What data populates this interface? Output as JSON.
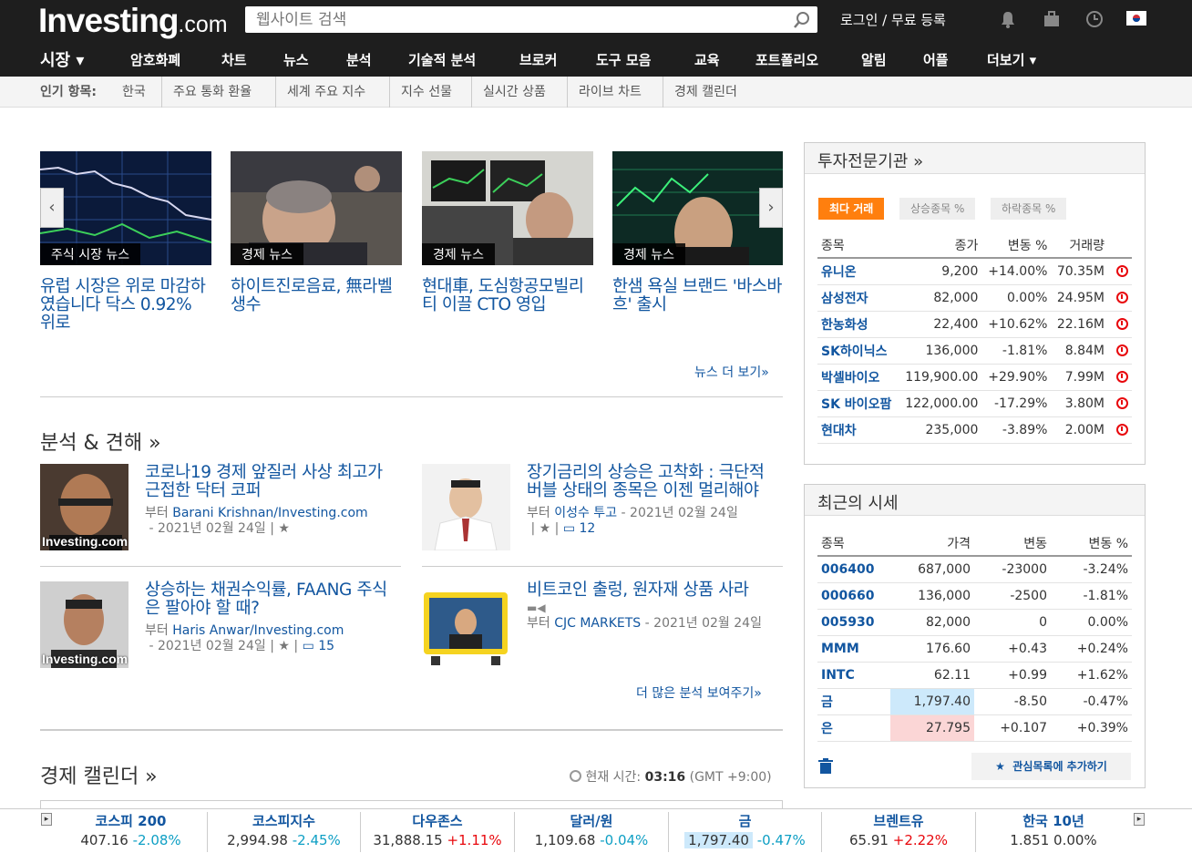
{
  "header": {
    "logo_main": "Investing",
    "logo_suffix": ".com",
    "search_placeholder": "웹사이트 검색",
    "login": "로그인 / 무료 등록"
  },
  "nav": {
    "items": [
      "시장 ▾",
      "암호화폐",
      "차트",
      "뉴스",
      "분석",
      "기술적 분석",
      "브로커",
      "도구 모음",
      "교육",
      "포트폴리오",
      "알림",
      "어플",
      "더보기 ▾"
    ]
  },
  "popular": {
    "label": "인기 항목:",
    "items": [
      "한국",
      "주요 통화 환율",
      "세계 주요 지수",
      "지수 선물",
      "실시간 상품",
      "라이브 차트",
      "경제 캘린더"
    ]
  },
  "news": {
    "items": [
      {
        "tag": "주식 시장 뉴스",
        "title": "유럽 시장은 위로 마감하였습니다 닥스 0.92% 위로"
      },
      {
        "tag": "경제 뉴스",
        "title": "하이트진로음료, 無라벨 생수"
      },
      {
        "tag": "경제 뉴스",
        "title": "현대車, 도심항공모빌리티 이끌 CTO 영입"
      },
      {
        "tag": "경제 뉴스",
        "title": "한샘 욕실 브랜드 '바스바흐' 출시"
      }
    ],
    "more": "뉴스 더 보기»"
  },
  "analysis": {
    "heading": "분석 & 견해 »",
    "items": [
      {
        "title": "코로나19 경제 앞질러 사상 최고가 근접한 닥터 코퍼",
        "by": "부터",
        "author": "Barani Krishnan/Investing.com",
        "date": "- 2021년 02월 24일",
        "comments": ""
      },
      {
        "title": "장기금리의 상승은 고착화 : 극단적 버블 상태의 종목은 이젠 멀리해야",
        "by": "부터",
        "author": "이성수 투고",
        "date": "- 2021년 02월 24일",
        "comments": "12"
      },
      {
        "title": "상승하는 채권수익률, FAANG 주식은 팔아야 할 때?",
        "by": "부터",
        "author": "Haris Anwar/Investing.com",
        "date": "- 2021년 02월 24일",
        "comments": "15"
      },
      {
        "title": "비트코인 출렁, 원자재 상품 사라",
        "by": "부터",
        "author": "CJC MARKETS",
        "date": "- 2021년 02월 24일",
        "comments": ""
      }
    ],
    "watermark": "Investing.com",
    "more": "더 많은 분석 보여주기»"
  },
  "calendar": {
    "heading": "경제 캘린더 »",
    "time_label": "현재 시간:",
    "time": "03:16",
    "tz": "(GMT +9:00)"
  },
  "pros": {
    "heading": "투자전문기관 »",
    "tabs": [
      "최다 거래",
      "상승종목 %",
      "하락종목 %"
    ],
    "columns": [
      "종목",
      "종가",
      "변동 %",
      "거래량"
    ],
    "rows": [
      {
        "name": "유니온",
        "price": "9,200",
        "chg": "+14.00%",
        "dir": "up",
        "vol": "70.35M"
      },
      {
        "name": "삼성전자",
        "price": "82,000",
        "chg": "0.00%",
        "dir": "flat",
        "vol": "24.95M"
      },
      {
        "name": "한농화성",
        "price": "22,400",
        "chg": "+10.62%",
        "dir": "up",
        "vol": "22.16M"
      },
      {
        "name": "SK하이닉스",
        "price": "136,000",
        "chg": "-1.81%",
        "dir": "dn",
        "vol": "8.84M"
      },
      {
        "name": "박셀바이오",
        "price": "119,900.00",
        "chg": "+29.90%",
        "dir": "up",
        "vol": "7.99M"
      },
      {
        "name": "SK 바이오팜",
        "price": "122,000.00",
        "chg": "-17.29%",
        "dir": "dn",
        "vol": "3.80M"
      },
      {
        "name": "현대차",
        "price": "235,000",
        "chg": "-3.89%",
        "dir": "dn",
        "vol": "2.00M"
      }
    ]
  },
  "recent": {
    "heading": "최근의 시세",
    "columns": [
      "종목",
      "가격",
      "변동",
      "변동 %"
    ],
    "rows": [
      {
        "name": "006400",
        "price": "687,000",
        "chg": "-23000",
        "pct": "-3.24%",
        "dir": "dn",
        "hl": ""
      },
      {
        "name": "000660",
        "price": "136,000",
        "chg": "-2500",
        "pct": "-1.81%",
        "dir": "dn",
        "hl": ""
      },
      {
        "name": "005930",
        "price": "82,000",
        "chg": "0",
        "pct": "0.00%",
        "dir": "flat",
        "hl": ""
      },
      {
        "name": "MMM",
        "price": "176.60",
        "chg": "+0.43",
        "pct": "+0.24%",
        "dir": "up",
        "hl": ""
      },
      {
        "name": "INTC",
        "price": "62.11",
        "chg": "+0.99",
        "pct": "+1.62%",
        "dir": "up",
        "hl": ""
      },
      {
        "name": "금",
        "price": "1,797.40",
        "chg": "-8.50",
        "pct": "-0.47%",
        "dir": "dn",
        "hl": "#cde9fb"
      },
      {
        "name": "은",
        "price": "27.795",
        "chg": "+0.107",
        "pct": "+0.39%",
        "dir": "up",
        "hl": "#fbd6d6"
      }
    ],
    "add_watchlist": "관심목록에 추가하기"
  },
  "ticker": {
    "items": [
      {
        "name": "코스피 200",
        "value": "407.16",
        "chg": "-2.08%",
        "dir": "dn"
      },
      {
        "name": "코스피지수",
        "value": "2,994.98",
        "chg": "-2.45%",
        "dir": "dn"
      },
      {
        "name": "다우존스",
        "value": "31,888.15",
        "chg": "+1.11%",
        "dir": "up"
      },
      {
        "name": "달러/원",
        "value": "1,109.68",
        "chg": "-0.04%",
        "dir": "dn"
      },
      {
        "name": "금",
        "value": "1,797.40",
        "chg": "-0.47%",
        "dir": "dn"
      },
      {
        "name": "브렌트유",
        "value": "65.91",
        "chg": "+2.22%",
        "dir": "up"
      },
      {
        "name": "한국 10년",
        "value": "1.851",
        "chg": "0.00%",
        "dir": "flat"
      }
    ]
  },
  "colors": {
    "link": "#1256a0",
    "up": "#e8070c",
    "down": "#0e9fc4",
    "accent": "#ff7f0e",
    "bar": "#1e1e1e"
  }
}
